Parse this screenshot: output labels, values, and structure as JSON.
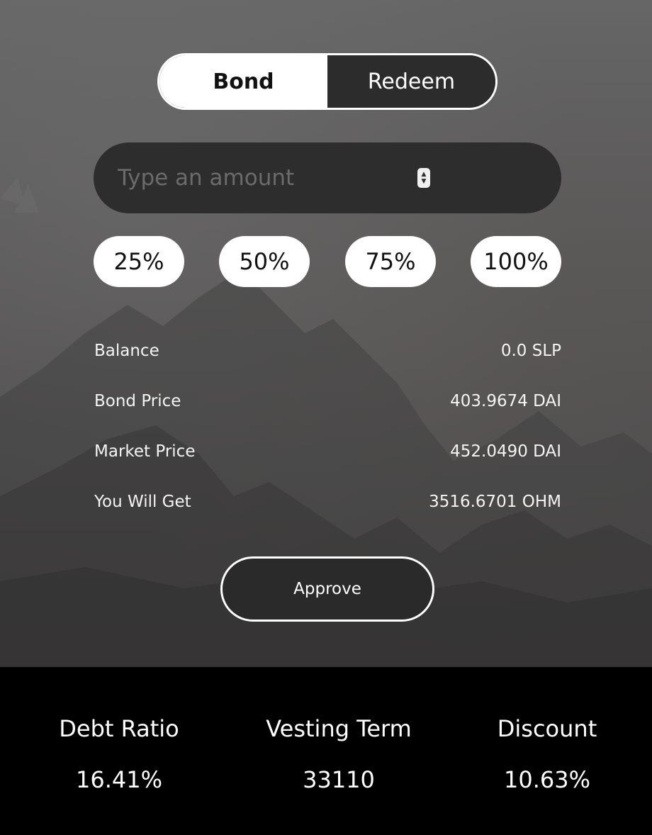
{
  "toggle": {
    "bond_label": "Bond",
    "redeem_label": "Redeem",
    "active": "Bond"
  },
  "amount_input": {
    "placeholder": "Type an amount",
    "value": ""
  },
  "percent_buttons": [
    "25%",
    "50%",
    "75%",
    "100%"
  ],
  "info": [
    {
      "label": "Balance",
      "value": "0.0 SLP"
    },
    {
      "label": "Bond Price",
      "value": "403.9674 DAI"
    },
    {
      "label": "Market Price",
      "value": "452.0490 DAI"
    },
    {
      "label": "You Will Get",
      "value": "3516.6701 OHM"
    }
  ],
  "approve_label": "Approve",
  "stats": [
    {
      "label": "Debt Ratio",
      "value": "16.41%"
    },
    {
      "label": "Vesting Term",
      "value": "33110"
    },
    {
      "label": "Discount",
      "value": "10.63%"
    }
  ],
  "colors": {
    "panel_dark": "#2d2d2d",
    "white": "#ffffff",
    "footer_bg": "#000000",
    "placeholder": "#6b6b6b"
  },
  "icons": {
    "stepper": "up-down-stepper-icon"
  }
}
